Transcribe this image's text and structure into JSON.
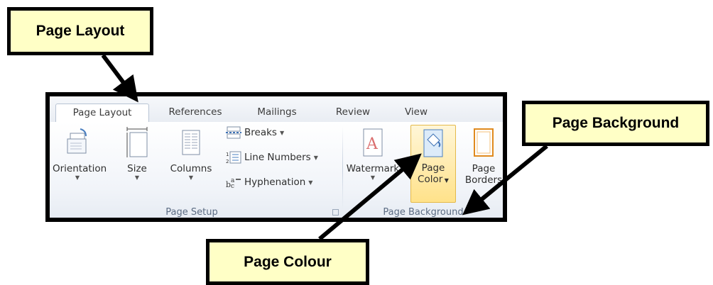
{
  "callouts": {
    "page_layout": "Page Layout",
    "page_background": "Page Background",
    "page_colour": "Page Colour"
  },
  "ribbon": {
    "tabs": [
      {
        "label": "Page Layout",
        "active": true
      },
      {
        "label": "References",
        "active": false
      },
      {
        "label": "Mailings",
        "active": false
      },
      {
        "label": "Review",
        "active": false
      },
      {
        "label": "View",
        "active": false
      }
    ],
    "page_setup": {
      "group_label": "Page Setup",
      "orientation": "Orientation",
      "size": "Size",
      "columns": "Columns",
      "breaks": "Breaks",
      "line_numbers": "Line Numbers",
      "hyphenation": "Hyphenation"
    },
    "page_background": {
      "group_label": "Page Background",
      "watermark": "Watermark",
      "page_color_line1": "Page",
      "page_color_line2": "Color",
      "page_borders_line1": "Page",
      "page_borders_line2": "Borders"
    }
  },
  "colors": {
    "callout_fill": "#ffffc6",
    "selected_fill": "#ffe28a",
    "frame": "#000000"
  }
}
